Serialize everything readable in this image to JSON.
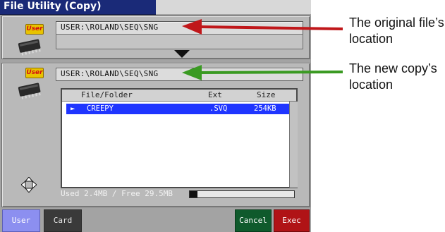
{
  "window": {
    "title": "File Utility (Copy)"
  },
  "source": {
    "badge": "User",
    "path": "USER:\\ROLAND\\SEQ\\SNG"
  },
  "destination": {
    "badge": "User",
    "path": "USER:\\ROLAND\\SEQ\\SNG",
    "list": {
      "headers": {
        "name": "File/Folder",
        "ext": "Ext",
        "size": "Size"
      },
      "rows": [
        {
          "marker": "►",
          "name": "CREEPY",
          "ext": ".SVQ",
          "size": "254KB"
        }
      ]
    },
    "usage_text": "Used 2.4MB / Free 29.5MB",
    "usage_fraction": 0.075
  },
  "buttons": {
    "user": "User",
    "card": "Card",
    "cancel": "Cancel",
    "exec": "Exec"
  },
  "annotations": {
    "original_line1": "The original file’s",
    "original_line2": "location",
    "new_line1": "The new copy’s",
    "new_line2": "location"
  },
  "colors": {
    "title_bar": "#1a2a78",
    "selection": "#1f35ff",
    "arrow_original": "#c0171a",
    "arrow_new": "#3a9a22",
    "cancel": "#0f5a2c",
    "exec": "#b01316"
  }
}
